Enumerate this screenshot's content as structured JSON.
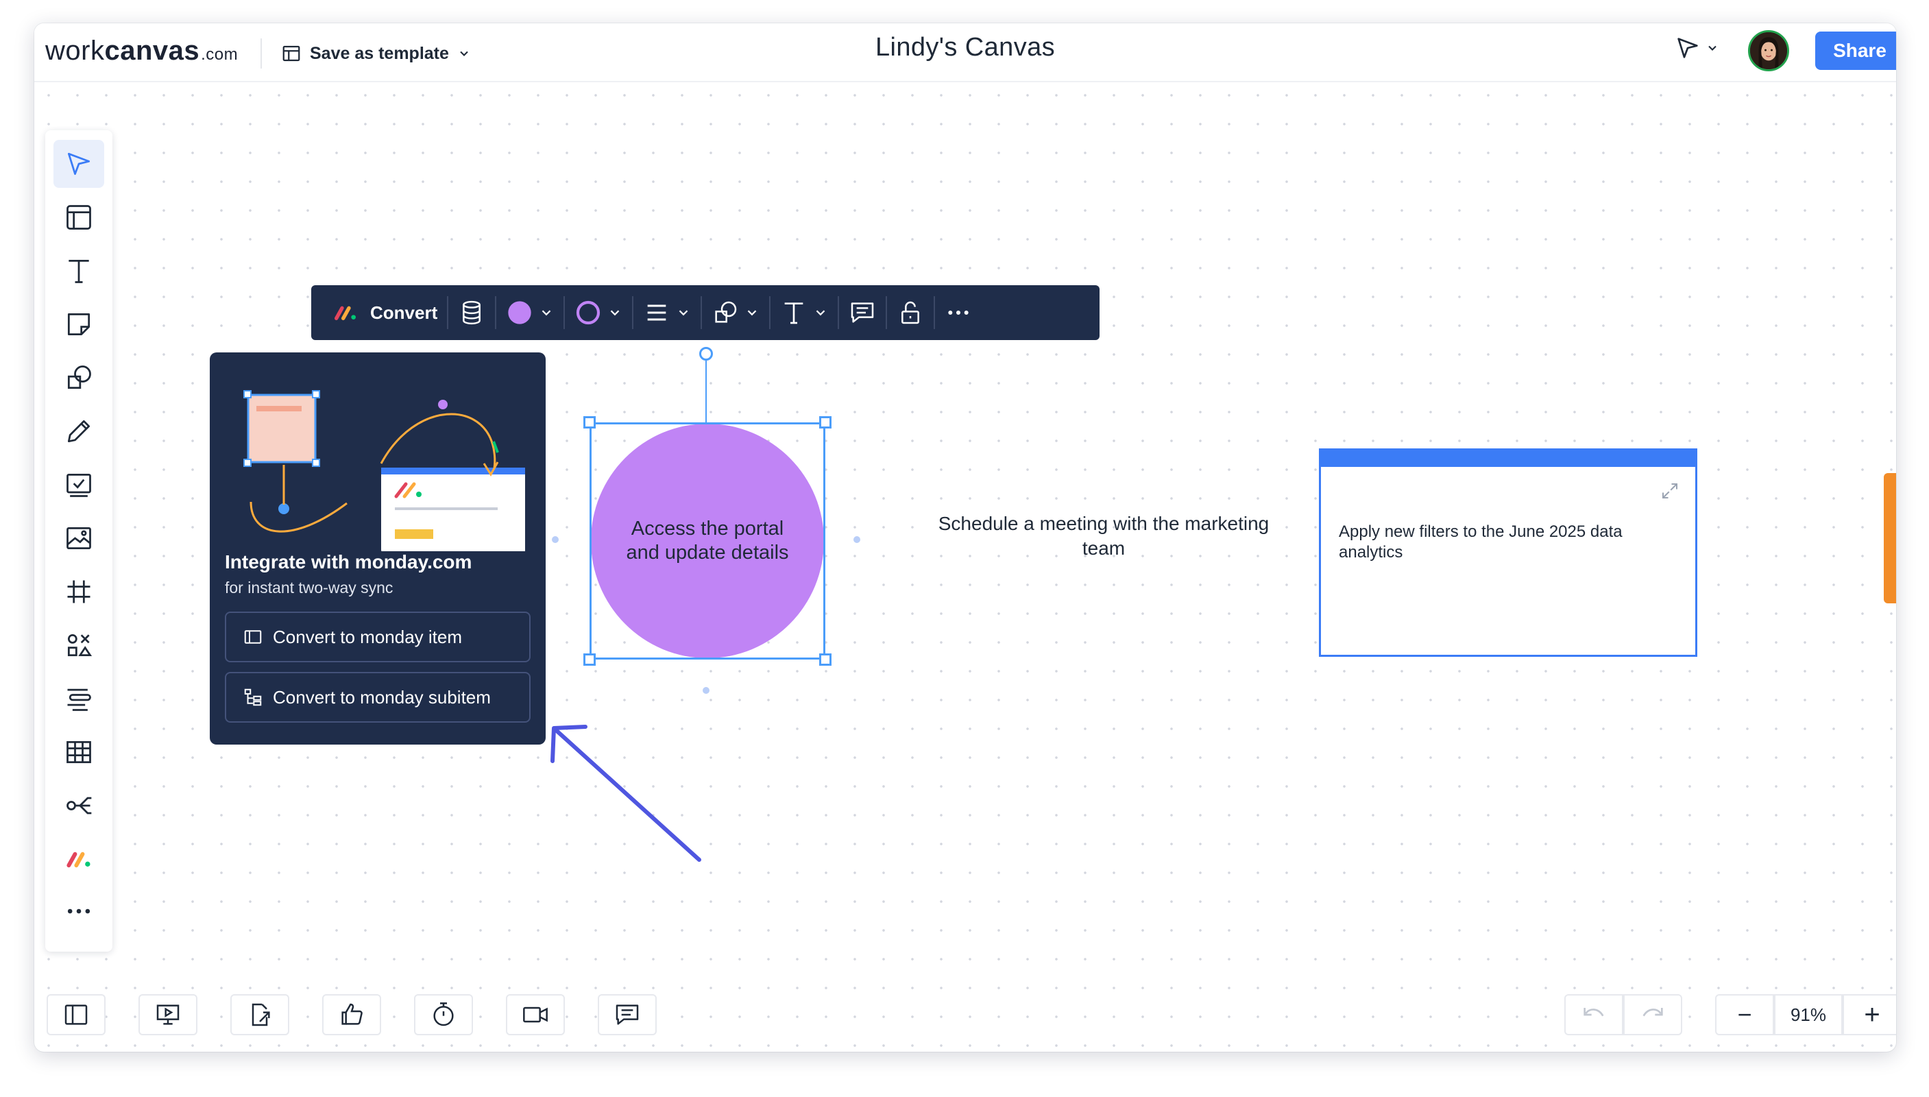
{
  "header": {
    "logo_word": "work",
    "logo_bold": "canvas",
    "logo_domain": ".com",
    "save_template_label": "Save as template",
    "canvas_title": "Lindy's Canvas",
    "share_label": "Share"
  },
  "left_toolbar": {
    "tools": [
      "select-tool",
      "frame-tool",
      "text-tool",
      "sticky-note-tool",
      "shapes-tool",
      "pen-tool",
      "task-tool",
      "image-tool",
      "grid-tool",
      "elements-tool",
      "list-tool",
      "table-tool",
      "mind-map-tool",
      "monday-tool",
      "more-tool"
    ]
  },
  "context_toolbar": {
    "convert_label": "Convert",
    "fill_color": "#c084f5",
    "stroke_color": "#c084f5"
  },
  "convert_panel": {
    "title": "Integrate with monday.com",
    "subtitle": "for instant two-way sync",
    "button_item": "Convert to monday item",
    "button_subitem": "Convert to monday subitem"
  },
  "canvas": {
    "circle_text": "Access the portal and update details",
    "free_text": "Schedule a meeting with the marketing team",
    "card_text": "Apply new filters to the June 2025 data analytics"
  },
  "bottom_bar": {
    "zoom_level": "91%",
    "zoom_out": "−",
    "zoom_in": "+"
  },
  "colors": {
    "accent": "#3b7cf6",
    "panel": "#1f2d4a",
    "shape_fill": "#c084f5",
    "tab": "#f28c28"
  }
}
